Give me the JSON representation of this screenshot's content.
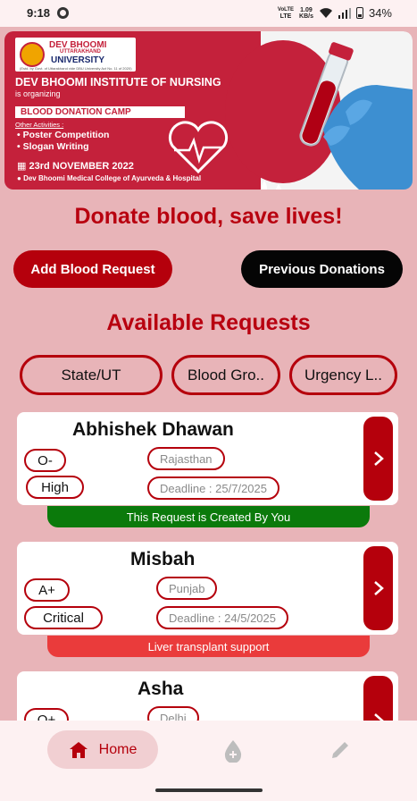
{
  "status_bar": {
    "time": "9:18",
    "volte": "VoLTE",
    "lte": "LTE",
    "speed_value": "1.09",
    "speed_unit": "KB/s",
    "battery": "34%"
  },
  "banner": {
    "logo_line1": "DEV BHOOMI",
    "logo_line2": "UTTARAKHAND",
    "logo_line3": "UNIVERSITY",
    "logo_line4": "(Estd. by Govt. of Uttarakhand vide DBU University Act No. 11 of 2020)",
    "institute": "DEV BHOOMI INSTITUTE OF NURSING",
    "organizing": "is organizing",
    "camp": "BLOOD DONATION CAMP",
    "other_activities": "Other Activities :",
    "activities": [
      "• Poster Competition",
      "• Slogan Writing"
    ],
    "date": "23rd NOVEMBER 2022",
    "venue": "Dev Bhoomi Medical College of Ayurveda & Hospital",
    "carousel_pages": 2,
    "carousel_active": 1
  },
  "slogan": "Donate blood, save lives!",
  "buttons": {
    "add_request": "Add Blood Request",
    "previous_donations": "Previous Donations"
  },
  "section_title": "Available Requests",
  "filters": [
    "State/UT",
    "Blood Gro..",
    "Urgency L.."
  ],
  "requests": [
    {
      "name": "Abhishek Dhawan",
      "blood_group": "O-",
      "urgency": "High",
      "state": "Rajasthan",
      "deadline": "Deadline : 25/7/2025",
      "note": "This Request is Created By You",
      "note_color": "#0b7a0b"
    },
    {
      "name": "Misbah",
      "blood_group": "A+",
      "urgency": "Critical",
      "state": "Punjab",
      "deadline": "Deadline : 24/5/2025",
      "note": "Liver transplant support",
      "note_color": "#ea3b3b"
    },
    {
      "name": "Asha",
      "blood_group": "O+",
      "state": "Delhi"
    }
  ],
  "nav": {
    "home": "Home",
    "home_icon": "home-icon",
    "donate_icon": "blood-drop-icon",
    "edit_icon": "pencil-icon"
  },
  "colors": {
    "primary": "#b5000c",
    "background": "#e8b4b8",
    "success": "#0b7a0b",
    "warning_red": "#ea3b3b"
  }
}
